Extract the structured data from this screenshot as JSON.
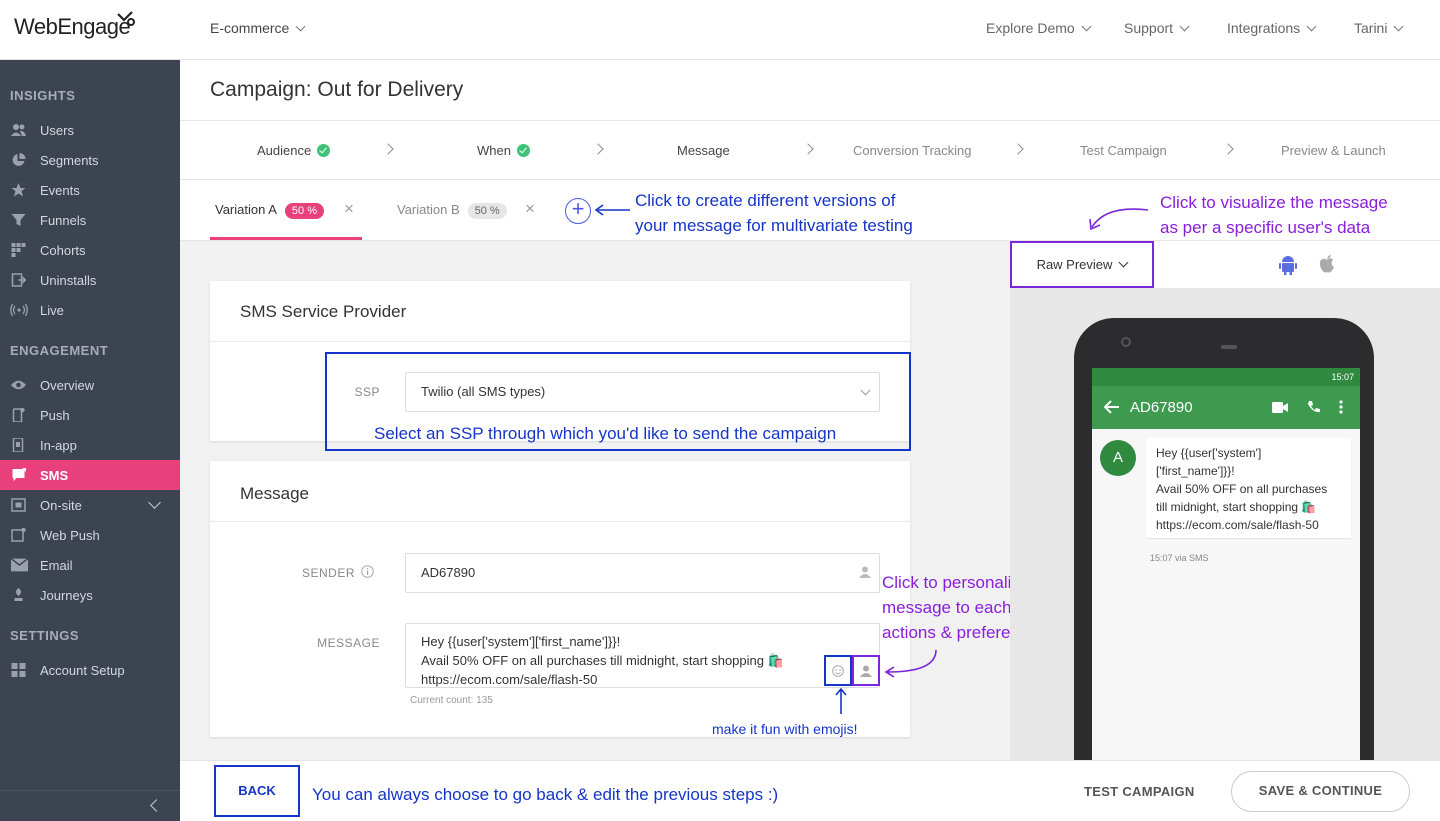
{
  "topbar": {
    "logo": "WebEngage",
    "project": "E-commerce",
    "nav": [
      "Explore Demo",
      "Support",
      "Integrations",
      "Tarini"
    ]
  },
  "sidebar": {
    "sections": [
      {
        "title": "INSIGHTS",
        "items": [
          {
            "label": "Users",
            "icon": "users-icon"
          },
          {
            "label": "Segments",
            "icon": "pie-chart-icon"
          },
          {
            "label": "Events",
            "icon": "star-icon"
          },
          {
            "label": "Funnels",
            "icon": "funnel-icon"
          },
          {
            "label": "Cohorts",
            "icon": "cohorts-icon"
          },
          {
            "label": "Uninstalls",
            "icon": "uninstall-icon"
          },
          {
            "label": "Live",
            "icon": "broadcast-icon"
          }
        ]
      },
      {
        "title": "ENGAGEMENT",
        "items": [
          {
            "label": "Overview",
            "icon": "eye-icon"
          },
          {
            "label": "Push",
            "icon": "mobile-icon"
          },
          {
            "label": "In-app",
            "icon": "in-app-icon"
          },
          {
            "label": "SMS",
            "icon": "sms-icon",
            "active": true
          },
          {
            "label": "On-site",
            "icon": "on-site-icon"
          },
          {
            "label": "Web Push",
            "icon": "web-push-icon"
          },
          {
            "label": "Email",
            "icon": "envelope-icon"
          },
          {
            "label": "Journeys",
            "icon": "journey-icon"
          }
        ]
      },
      {
        "title": "SETTINGS",
        "items": [
          {
            "label": "Account Setup",
            "icon": "grid-icon"
          }
        ]
      }
    ]
  },
  "page": {
    "title": "Campaign: Out for Delivery"
  },
  "steps": [
    {
      "label": "Audience",
      "done": true
    },
    {
      "label": "When",
      "done": true
    },
    {
      "label": "Message",
      "current": true
    },
    {
      "label": "Conversion Tracking"
    },
    {
      "label": "Test Campaign"
    },
    {
      "label": "Preview & Launch"
    }
  ],
  "variations": [
    {
      "label": "Variation A",
      "pct": "50 %"
    },
    {
      "label": "Variation B",
      "pct": "50 %"
    }
  ],
  "annotations": {
    "add_variation": "Click to create different versions of\nyour message for multivariate testing",
    "visualize": "Click to visualize the message\nas per a specific user's data",
    "ssp": "Select an SSP through which you'd like to send the campaign",
    "personalize": "Click to personalize\nmessage to each user's\nactions & preferences",
    "emoji": "make it fun with emojis!",
    "back": "You can always choose to go back & edit the previous steps :)"
  },
  "ssp_card": {
    "title": "SMS Service Provider",
    "label": "SSP",
    "value": "Twilio (all SMS types)"
  },
  "message_card": {
    "title": "Message",
    "sender_label": "SENDER",
    "sender_value": "AD67890",
    "message_label": "MESSAGE",
    "message_lines": [
      "Hey {{user['system']['first_name']}}!",
      "Avail 50% OFF on all purchases  till midnight, start shopping 🛍️",
      "https://ecom.com/sale/flash-50"
    ],
    "count": "Current count: 135"
  },
  "preview": {
    "mode": "Raw Preview",
    "status_time": "15:07",
    "contact": "AD67890",
    "avatar_letter": "A",
    "bubble_lines": [
      "Hey {{user['system']",
      "['first_name']}}!",
      "Avail 50% OFF on all purchases",
      "till midnight, start shopping 🛍️",
      "https://ecom.com/sale/flash-50"
    ],
    "meta": "15:07 via SMS"
  },
  "footer": {
    "back": "BACK",
    "test": "TEST CAMPAIGN",
    "save": "SAVE & CONTINUE"
  },
  "colors": {
    "accent": "#e8407b",
    "sidebar": "#3d4451",
    "annot_blue": "#1535c8",
    "annot_purple": "#8a1ddb",
    "android_green": "#3d9a4f"
  }
}
